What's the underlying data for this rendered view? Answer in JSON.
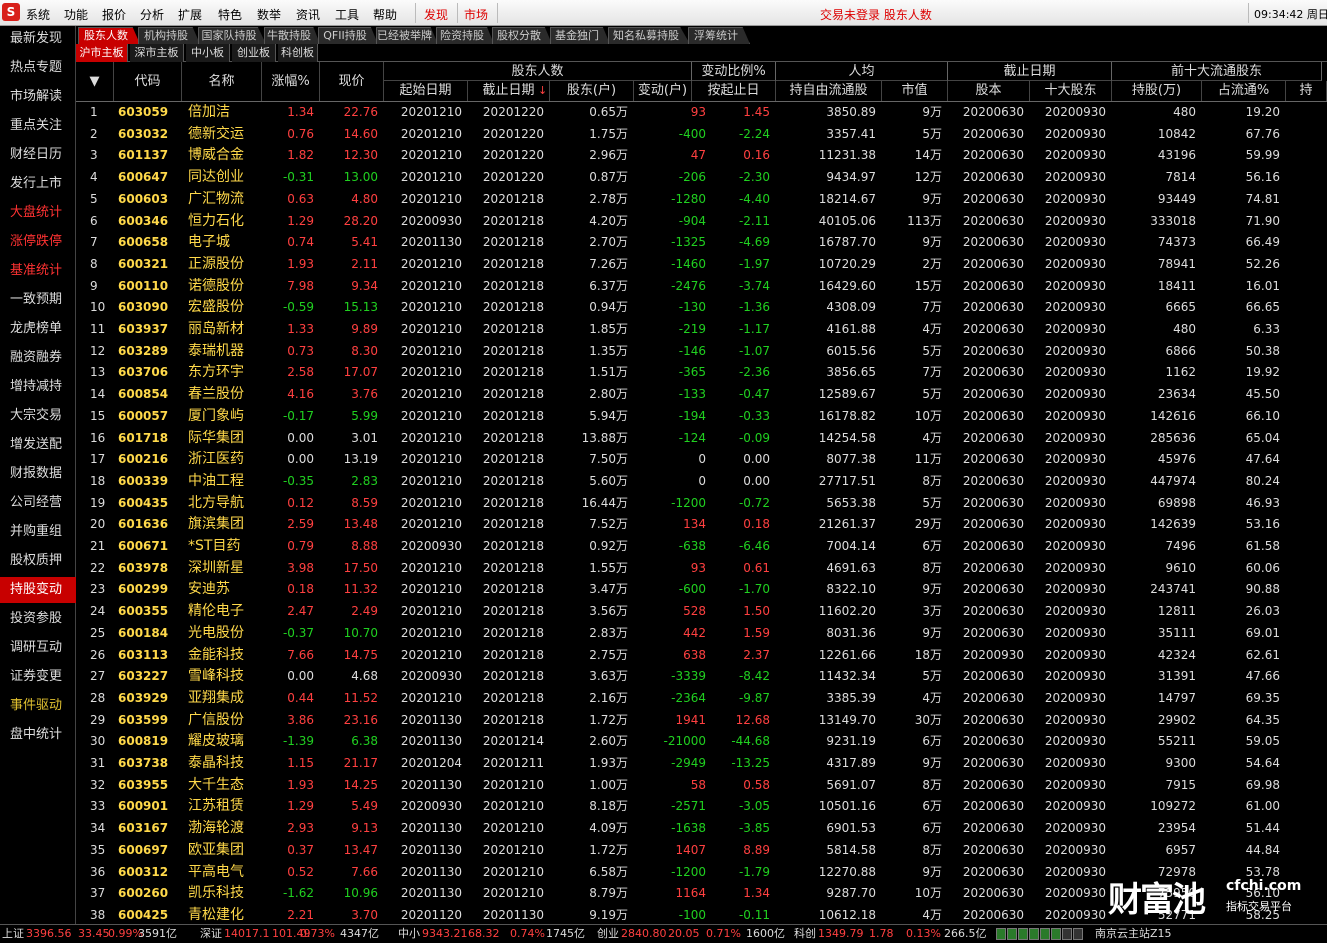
{
  "menubar": {
    "logo": "S",
    "items": [
      "系统",
      "功能",
      "报价",
      "分析",
      "扩展",
      "特色",
      "数举",
      "资讯",
      "工具",
      "帮助"
    ],
    "special": [
      "发现",
      "市场"
    ],
    "status_msg": "交易未登录  股东人数",
    "clock": "09:34:42 周日"
  },
  "sidebar": {
    "items": [
      {
        "label": "最新发现",
        "style": "normal"
      },
      {
        "label": "热点专题",
        "style": "normal"
      },
      {
        "label": "市场解读",
        "style": "normal"
      },
      {
        "label": "重点关注",
        "style": "normal"
      },
      {
        "label": "财经日历",
        "style": "normal"
      },
      {
        "label": "发行上市",
        "style": "normal"
      },
      {
        "label": "大盘统计",
        "style": "red"
      },
      {
        "label": "涨停跌停",
        "style": "red"
      },
      {
        "label": "基准统计",
        "style": "red"
      },
      {
        "label": "一致预期",
        "style": "normal"
      },
      {
        "label": "龙虎榜单",
        "style": "normal"
      },
      {
        "label": "融资融券",
        "style": "normal"
      },
      {
        "label": "增持减持",
        "style": "normal"
      },
      {
        "label": "大宗交易",
        "style": "normal"
      },
      {
        "label": "增发送配",
        "style": "normal"
      },
      {
        "label": "财报数据",
        "style": "normal"
      },
      {
        "label": "公司经营",
        "style": "normal"
      },
      {
        "label": "并购重组",
        "style": "normal"
      },
      {
        "label": "股权质押",
        "style": "normal"
      },
      {
        "label": "持股变动",
        "style": "active"
      },
      {
        "label": "投资参股",
        "style": "normal"
      },
      {
        "label": "调研互动",
        "style": "normal"
      },
      {
        "label": "证券变更",
        "style": "normal"
      },
      {
        "label": "事件驱动",
        "style": "org"
      },
      {
        "label": "盘中统计",
        "style": "normal"
      }
    ]
  },
  "tabs": [
    "股东人数",
    "机构持股",
    "国家队持股",
    "牛散持股",
    "QFII持股",
    "已经被举牌",
    "险资持股",
    "股权分散",
    "基金独门",
    "知名私募持股",
    "浮筹统计"
  ],
  "subtabs": [
    "沪市主板",
    "深市主板",
    "中小板",
    "创业板",
    "科创板"
  ],
  "header": {
    "groups": [
      "股东人数",
      "变动比例%",
      "人均",
      "截止日期",
      "前十大流通股东"
    ],
    "cols": [
      "代码",
      "名称",
      "涨幅%",
      "现价",
      "起始日期",
      "截止日期",
      "股东(户)",
      "变动(户)",
      "按起止日",
      "持自由流通股",
      "市值",
      "股本",
      "十大股东",
      "持股(万)",
      "占流通%",
      "持"
    ],
    "sort_arrow": "▼",
    "sort_marker": "↓"
  },
  "rows": [
    [
      "1",
      "603059",
      "倍加洁",
      "1.34",
      "22.76",
      "20201210",
      "20201220",
      "0.65万",
      "93",
      "1.45",
      "3850.89",
      "9万",
      "20200630",
      "20200930",
      "480",
      "19.20"
    ],
    [
      "2",
      "603032",
      "德新交运",
      "0.76",
      "14.60",
      "20201210",
      "20201220",
      "1.75万",
      "-400",
      "-2.24",
      "3357.41",
      "5万",
      "20200630",
      "20200930",
      "10842",
      "67.76"
    ],
    [
      "3",
      "601137",
      "博威合金",
      "1.82",
      "12.30",
      "20201210",
      "20201220",
      "2.96万",
      "47",
      "0.16",
      "11231.38",
      "14万",
      "20200630",
      "20200930",
      "43196",
      "59.99"
    ],
    [
      "4",
      "600647",
      "同达创业",
      "-0.31",
      "13.00",
      "20201210",
      "20201220",
      "0.87万",
      "-206",
      "-2.30",
      "9434.97",
      "12万",
      "20200630",
      "20200930",
      "7814",
      "56.16"
    ],
    [
      "5",
      "600603",
      "广汇物流",
      "0.63",
      "4.80",
      "20201210",
      "20201218",
      "2.78万",
      "-1280",
      "-4.40",
      "18214.67",
      "9万",
      "20200630",
      "20200930",
      "93449",
      "74.81"
    ],
    [
      "6",
      "600346",
      "恒力石化",
      "1.29",
      "28.20",
      "20200930",
      "20201218",
      "4.20万",
      "-904",
      "-2.11",
      "40105.06",
      "113万",
      "20200630",
      "20200930",
      "333018",
      "71.90"
    ],
    [
      "7",
      "600658",
      "电子城",
      "0.74",
      "5.41",
      "20201130",
      "20201218",
      "2.70万",
      "-1325",
      "-4.69",
      "16787.70",
      "9万",
      "20200630",
      "20200930",
      "74373",
      "66.49"
    ],
    [
      "8",
      "600321",
      "正源股份",
      "1.93",
      "2.11",
      "20201210",
      "20201218",
      "7.26万",
      "-1460",
      "-1.97",
      "10720.29",
      "2万",
      "20200630",
      "20200930",
      "78941",
      "52.26"
    ],
    [
      "9",
      "600110",
      "诺德股份",
      "7.98",
      "9.34",
      "20201210",
      "20201218",
      "6.37万",
      "-2476",
      "-3.74",
      "16429.60",
      "15万",
      "20200630",
      "20200930",
      "18411",
      "16.01"
    ],
    [
      "10",
      "603090",
      "宏盛股份",
      "-0.59",
      "15.13",
      "20201210",
      "20201218",
      "0.94万",
      "-130",
      "-1.36",
      "4308.09",
      "7万",
      "20200630",
      "20200930",
      "6665",
      "66.65"
    ],
    [
      "11",
      "603937",
      "丽岛新材",
      "1.33",
      "9.89",
      "20201210",
      "20201218",
      "1.85万",
      "-219",
      "-1.17",
      "4161.88",
      "4万",
      "20200630",
      "20200930",
      "480",
      "6.33"
    ],
    [
      "12",
      "603289",
      "泰瑞机器",
      "0.73",
      "8.30",
      "20201210",
      "20201218",
      "1.35万",
      "-146",
      "-1.07",
      "6015.56",
      "5万",
      "20200630",
      "20200930",
      "6866",
      "50.38"
    ],
    [
      "13",
      "603706",
      "东方环宇",
      "2.58",
      "17.07",
      "20201210",
      "20201218",
      "1.51万",
      "-365",
      "-2.36",
      "3856.65",
      "7万",
      "20200630",
      "20200930",
      "1162",
      "19.92"
    ],
    [
      "14",
      "600854",
      "春兰股份",
      "4.16",
      "3.76",
      "20201210",
      "20201218",
      "2.80万",
      "-133",
      "-0.47",
      "12589.67",
      "5万",
      "20200630",
      "20200930",
      "23634",
      "45.50"
    ],
    [
      "15",
      "600057",
      "厦门象屿",
      "-0.17",
      "5.99",
      "20201210",
      "20201218",
      "5.94万",
      "-194",
      "-0.33",
      "16178.82",
      "10万",
      "20200630",
      "20200930",
      "142616",
      "66.10"
    ],
    [
      "16",
      "601718",
      "际华集团",
      "0.00",
      "3.01",
      "20201210",
      "20201218",
      "13.88万",
      "-124",
      "-0.09",
      "14254.58",
      "4万",
      "20200630",
      "20200930",
      "285636",
      "65.04"
    ],
    [
      "17",
      "600216",
      "浙江医药",
      "0.00",
      "13.19",
      "20201210",
      "20201218",
      "7.50万",
      "0",
      "0.00",
      "8077.38",
      "11万",
      "20200630",
      "20200930",
      "45976",
      "47.64"
    ],
    [
      "18",
      "600339",
      "中油工程",
      "-0.35",
      "2.83",
      "20201210",
      "20201218",
      "5.60万",
      "0",
      "0.00",
      "27717.51",
      "8万",
      "20200630",
      "20200930",
      "447974",
      "80.24"
    ],
    [
      "19",
      "600435",
      "北方导航",
      "0.12",
      "8.59",
      "20201210",
      "20201218",
      "16.44万",
      "-1200",
      "-0.72",
      "5653.38",
      "5万",
      "20200630",
      "20200930",
      "69898",
      "46.93"
    ],
    [
      "20",
      "601636",
      "旗滨集团",
      "2.59",
      "13.48",
      "20201210",
      "20201218",
      "7.52万",
      "134",
      "0.18",
      "21261.37",
      "29万",
      "20200630",
      "20200930",
      "142639",
      "53.16"
    ],
    [
      "21",
      "600671",
      "*ST目药",
      "0.79",
      "8.88",
      "20200930",
      "20201218",
      "0.92万",
      "-638",
      "-6.46",
      "7004.14",
      "6万",
      "20200630",
      "20200930",
      "7496",
      "61.58"
    ],
    [
      "22",
      "603978",
      "深圳新星",
      "3.98",
      "17.50",
      "20201210",
      "20201218",
      "1.55万",
      "93",
      "0.61",
      "4691.63",
      "8万",
      "20200630",
      "20200930",
      "9610",
      "60.06"
    ],
    [
      "23",
      "600299",
      "安迪苏",
      "0.18",
      "11.32",
      "20201210",
      "20201218",
      "3.47万",
      "-600",
      "-1.70",
      "8322.10",
      "9万",
      "20200630",
      "20200930",
      "243741",
      "90.88"
    ],
    [
      "24",
      "600355",
      "精伦电子",
      "2.47",
      "2.49",
      "20201210",
      "20201218",
      "3.56万",
      "528",
      "1.50",
      "11602.20",
      "3万",
      "20200630",
      "20200930",
      "12811",
      "26.03"
    ],
    [
      "25",
      "600184",
      "光电股份",
      "-0.37",
      "10.70",
      "20201210",
      "20201218",
      "2.83万",
      "442",
      "1.59",
      "8031.36",
      "9万",
      "20200630",
      "20200930",
      "35111",
      "69.01"
    ],
    [
      "26",
      "603113",
      "金能科技",
      "7.66",
      "14.75",
      "20201210",
      "20201218",
      "2.75万",
      "638",
      "2.37",
      "12261.66",
      "18万",
      "20200930",
      "20200930",
      "42324",
      "62.61"
    ],
    [
      "27",
      "603227",
      "雪峰科技",
      "0.00",
      "4.68",
      "20200930",
      "20201218",
      "3.63万",
      "-3339",
      "-8.42",
      "11432.34",
      "5万",
      "20200630",
      "20200930",
      "31391",
      "47.66"
    ],
    [
      "28",
      "603929",
      "亚翔集成",
      "0.44",
      "11.52",
      "20201210",
      "20201218",
      "2.16万",
      "-2364",
      "-9.87",
      "3385.39",
      "4万",
      "20200630",
      "20200930",
      "14797",
      "69.35"
    ],
    [
      "29",
      "603599",
      "广信股份",
      "3.86",
      "23.16",
      "20201130",
      "20201218",
      "1.72万",
      "1941",
      "12.68",
      "13149.70",
      "30万",
      "20200630",
      "20200930",
      "29902",
      "64.35"
    ],
    [
      "30",
      "600819",
      "耀皮玻璃",
      "-1.39",
      "6.38",
      "20201130",
      "20201214",
      "2.60万",
      "-21000",
      "-44.68",
      "9231.19",
      "6万",
      "20200630",
      "20200930",
      "55211",
      "59.05"
    ],
    [
      "31",
      "603738",
      "泰晶科技",
      "1.15",
      "21.17",
      "20201204",
      "20201211",
      "1.93万",
      "-2949",
      "-13.25",
      "4317.89",
      "9万",
      "20200630",
      "20200930",
      "9300",
      "54.64"
    ],
    [
      "32",
      "603955",
      "大千生态",
      "1.93",
      "14.25",
      "20201130",
      "20201210",
      "1.00万",
      "58",
      "0.58",
      "5691.07",
      "8万",
      "20200630",
      "20200930",
      "7915",
      "69.98"
    ],
    [
      "33",
      "600901",
      "江苏租赁",
      "1.29",
      "5.49",
      "20200930",
      "20201210",
      "8.18万",
      "-2571",
      "-3.05",
      "10501.16",
      "6万",
      "20200630",
      "20200930",
      "109272",
      "61.00"
    ],
    [
      "34",
      "603167",
      "渤海轮渡",
      "2.93",
      "9.13",
      "20201130",
      "20201210",
      "4.09万",
      "-1638",
      "-3.85",
      "6901.53",
      "6万",
      "20200630",
      "20200930",
      "23954",
      "51.44"
    ],
    [
      "35",
      "600697",
      "欧亚集团",
      "0.37",
      "13.47",
      "20201130",
      "20201210",
      "1.72万",
      "1407",
      "8.89",
      "5814.58",
      "8万",
      "20200630",
      "20200930",
      "6957",
      "44.84"
    ],
    [
      "36",
      "600312",
      "平高电气",
      "0.52",
      "7.66",
      "20201130",
      "20201210",
      "6.58万",
      "-1200",
      "-1.79",
      "12270.88",
      "9万",
      "20200630",
      "20200930",
      "72978",
      "53.78"
    ],
    [
      "37",
      "600260",
      "凯乐科技",
      "-1.62",
      "10.96",
      "20201130",
      "20201210",
      "8.79万",
      "1164",
      "1.34",
      "9287.70",
      "10万",
      "20200630",
      "20200930",
      "75950",
      "56.10"
    ],
    [
      "38",
      "600425",
      "青松建化",
      "2.21",
      "3.70",
      "20201120",
      "20201130",
      "9.19万",
      "-100",
      "-0.11",
      "10612.18",
      "4万",
      "20200630",
      "20200930",
      "52771",
      "58.25"
    ]
  ],
  "statusbar": [
    {
      "label": "上证",
      "v1": "3396.56",
      "v2": "33.45",
      "v3": "0.99%",
      "v4": "3591亿"
    },
    {
      "label": "深证",
      "v1": "14017.1",
      "v2": "101.49",
      "v3": "0.73%",
      "v4": "4347亿"
    },
    {
      "label": "中小",
      "v1": "9343.21",
      "v2": "68.32",
      "v3": "0.74%",
      "v4": "1745亿"
    },
    {
      "label": "创业",
      "v1": "2840.80",
      "v2": "20.05",
      "v3": "0.71%",
      "v4": "1600亿"
    },
    {
      "label": "科创",
      "v1": "1349.79",
      "v2": "1.78",
      "v3": "0.13%",
      "v4": "266.5亿"
    }
  ],
  "server": "南京云主站Z15",
  "watermark": {
    "main": "财富池",
    "url": "cfchi.com",
    "sub": "指标交易平台"
  },
  "colors": {
    "up": "#ff4040",
    "down": "#20d020",
    "active": "#c80000",
    "code": "#ffd94a"
  }
}
